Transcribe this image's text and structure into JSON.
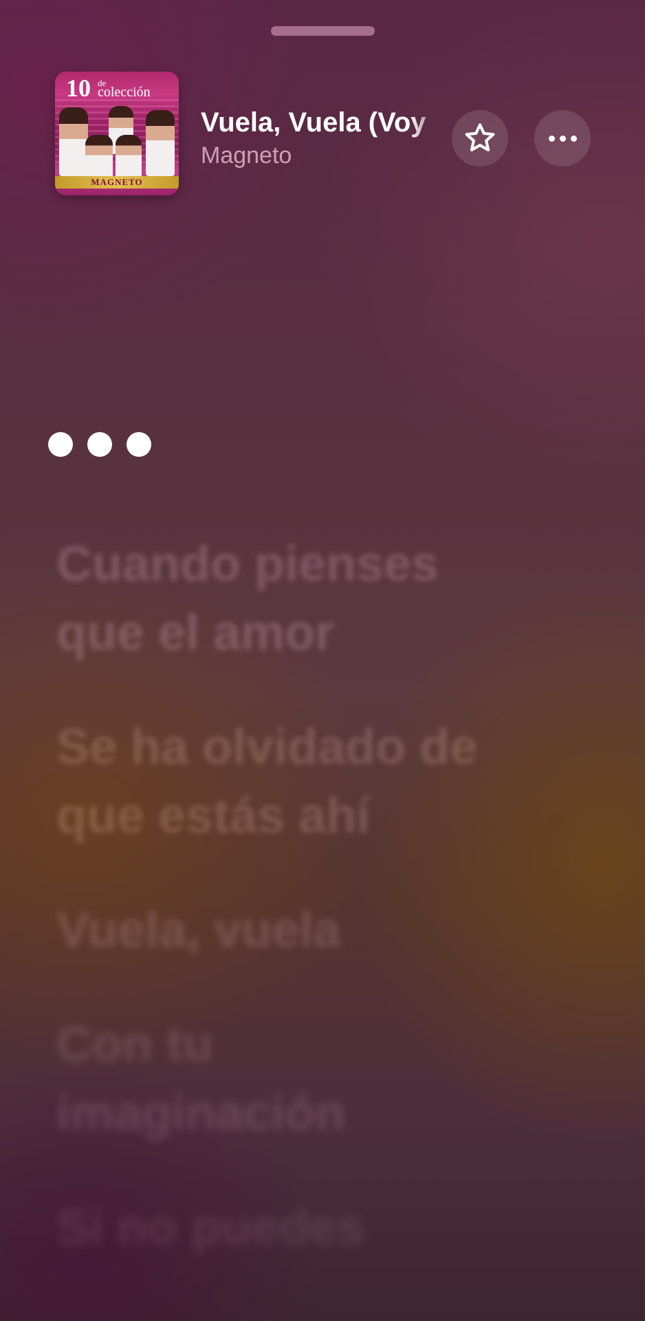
{
  "player": {
    "song_title": "Vuela, Vuela (Voy",
    "artist": "Magneto",
    "album_art": {
      "title_number": "10",
      "title_de": "de",
      "title_word": "colección",
      "band": "MAGNETO"
    }
  },
  "icons": {
    "favorite": "star-outline-icon",
    "more": "ellipsis-icon",
    "loading": "three-dots-indicator"
  },
  "lyrics": [
    "Cuando pienses\nque el amor",
    "Se ha olvidado de\nque estás ahí",
    "Vuela, vuela",
    "Con tu\nimaginación",
    "Si no puedes"
  ],
  "colors": {
    "text_primary": "#ffffff",
    "text_secondary": "#ebbed2",
    "background_top": "#5a2745",
    "background_mid": "#5b3940",
    "background_bottom": "#3e2530"
  }
}
